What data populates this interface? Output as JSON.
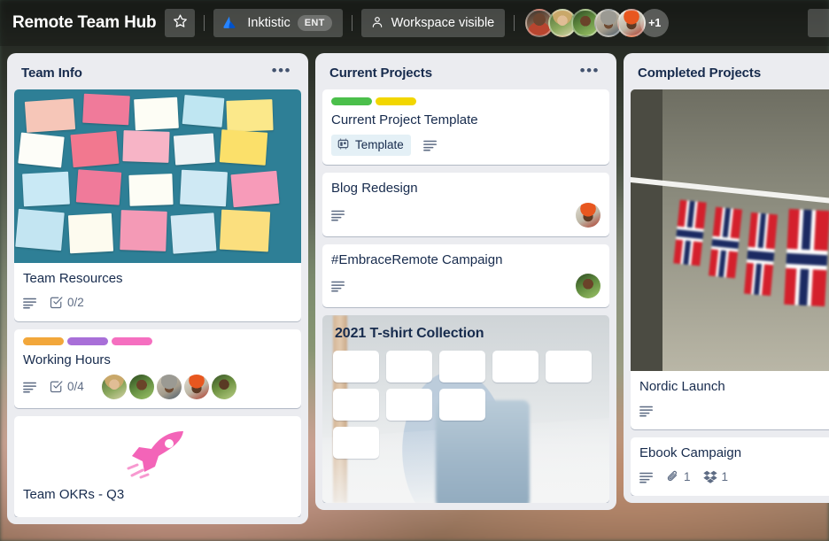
{
  "topbar": {
    "board_title": "Remote Team Hub",
    "star_icon": "star-icon",
    "workspace": {
      "logo_icon": "inktistic-logo-icon",
      "name": "Inktistic",
      "plan_badge": "ENT"
    },
    "visibility": {
      "icon": "workspace-visible-icon",
      "label": "Workspace visible"
    },
    "members_overflow": "+1",
    "member_count_visible": 5
  },
  "lists": [
    {
      "title": "Team Info",
      "menu_icon": "list-menu-icon",
      "cards": [
        {
          "title": "Team Resources",
          "cover": "sticky-notes-photo",
          "badges": [
            {
              "icon": "description-icon"
            },
            {
              "icon": "checklist-icon",
              "text": "0/2"
            }
          ],
          "labels": [],
          "members": []
        },
        {
          "title": "Working Hours",
          "labels": [
            "#F2A73B",
            "#A86FD8",
            "#F56FC0"
          ],
          "badges": [
            {
              "icon": "description-icon"
            },
            {
              "icon": "checklist-icon",
              "text": "0/4"
            }
          ],
          "members": [
            "f2",
            "f3",
            "f4",
            "f5",
            "f6"
          ]
        },
        {
          "title": "Team OKRs - Q3",
          "cover": "rocket-sticker",
          "labels": [],
          "badges": [],
          "members": []
        }
      ]
    },
    {
      "title": "Current Projects",
      "menu_icon": "list-menu-icon",
      "cards": [
        {
          "title": "Current Project Template",
          "labels": [
            "#4BBF4B",
            "#F2D600"
          ],
          "template_badge": {
            "icon": "template-icon",
            "label": "Template"
          },
          "badges": [
            {
              "icon": "description-icon"
            }
          ],
          "members": []
        },
        {
          "title": "Blog Redesign",
          "labels": [],
          "badges": [
            {
              "icon": "description-icon"
            }
          ],
          "members": [
            "f5"
          ]
        },
        {
          "title": "#EmbraceRemote Campaign",
          "labels": [],
          "badges": [
            {
              "icon": "description-icon"
            }
          ],
          "members": [
            "f3"
          ]
        },
        {
          "title": "2021 T-shirt Collection",
          "cover": "tshirt-photo-full",
          "labels": [],
          "badges": [],
          "members": []
        }
      ]
    },
    {
      "title": "Completed Projects",
      "menu_icon": "list-menu-icon",
      "cards": [
        {
          "title": "Nordic Launch",
          "cover": "norway-flags-photo",
          "labels": [],
          "badges": [
            {
              "icon": "description-icon"
            }
          ],
          "members": []
        },
        {
          "title": "Ebook Campaign",
          "labels": [],
          "badges": [
            {
              "icon": "description-icon"
            },
            {
              "icon": "attachment-icon",
              "text": "1"
            },
            {
              "icon": "dropbox-icon",
              "text": "1"
            }
          ],
          "members": []
        }
      ]
    }
  ]
}
